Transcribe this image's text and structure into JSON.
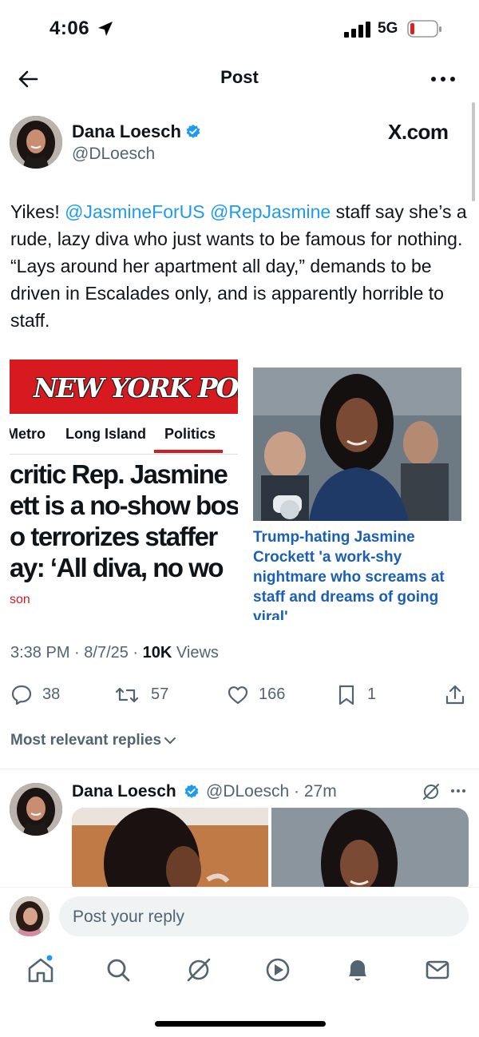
{
  "status_bar": {
    "time": "4:06",
    "network": "5G",
    "location_icon": "location-arrow-icon",
    "signal_icon": "signal-bars-icon",
    "battery_icon": "battery-low-icon"
  },
  "nav": {
    "title": "Post",
    "back_icon": "back-arrow-icon",
    "more_icon": "more-horizontal-icon"
  },
  "author": {
    "name": "Dana Loesch",
    "handle": "@DLoesch",
    "verified": true,
    "source_label": "X.com"
  },
  "tweet": {
    "text_before": "Yikes! ",
    "mention_1": "@JasmineForUS",
    "mention_2": "@RepJasmine",
    "text_after": " staff say she’s a rude, lazy diva who just wants to be famous for nothing. “Lays around her apartment all day,” demands to be driven in Escalades only, and is apparently horrible to staff."
  },
  "media": {
    "left_card": {
      "masthead": "NEW YORK POST",
      "nav_items": [
        "Metro",
        "Long Island",
        "Politics"
      ],
      "active_nav": "Politics",
      "headline_lines": [
        "critic Rep. Jasmine",
        "ett is a no-show bos",
        "o terrorizes staffer",
        "ay: ‘All diva, no wo"
      ],
      "tag": "son"
    },
    "right_card": {
      "title": "Trump-hating Jasmine Crockett 'a work-shy nightmare who screams at staff and dreams of going viral'"
    }
  },
  "meta": {
    "time": "3:38 PM",
    "date": "8/7/25",
    "views_count": "10K",
    "views_label": "Views"
  },
  "actions": {
    "replies": "38",
    "reposts": "57",
    "likes": "166",
    "bookmarks": "1"
  },
  "replies_section": {
    "sort_label": "Most relevant replies"
  },
  "reply": {
    "name": "Dana Loesch",
    "handle": "@DLoesch · 27m"
  },
  "compose": {
    "placeholder": "Post your reply"
  },
  "tab_bar": {
    "icons": [
      "home-icon",
      "search-icon",
      "grok-icon",
      "video-icon",
      "notifications-icon",
      "messages-icon"
    ]
  },
  "colors": {
    "accent": "#1d9bf0",
    "text_primary": "#0f1419",
    "text_secondary": "#536471",
    "nyp_red": "#d71920",
    "link_blue": "#1a5fb4"
  }
}
